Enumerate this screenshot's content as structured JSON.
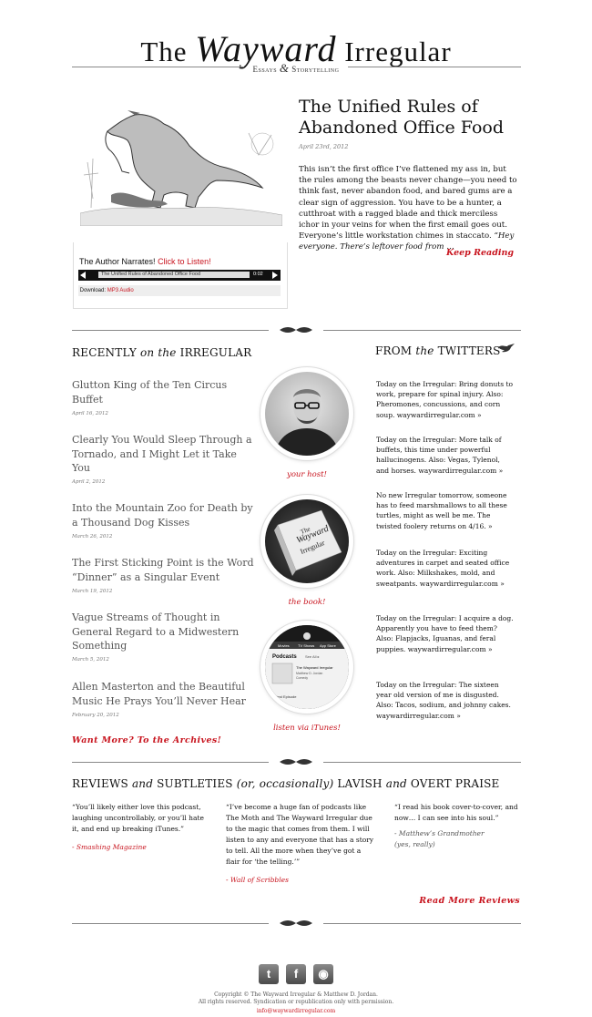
{
  "header": {
    "title_pre": "The ",
    "title_script": "Wayward",
    "title_post": " Irregular",
    "tagline_left": "Essays",
    "tagline_amp": "&",
    "tagline_right": "Storytelling"
  },
  "feature": {
    "title": "The Unified Rules of Abandoned Office Food",
    "date": "April 23rd, 2012",
    "excerpt": "This isn’t the first office I’ve flattened my ass in, but the rules among the beasts never change—you need to think fast, never abandon food, and bared gums are a clear sign of aggression. You have to be a hunter, a cutthroat with a ragged blade and thick merciless ichor in your veins for when the first email goes out. Everyone’s little workstation chimes in staccato.",
    "excerpt_italic": "“Hey everyone. There’s leftover food from …",
    "keep_reading": "Keep Reading",
    "audio": {
      "label": "The Author Narrates!",
      "link": "Click to Listen!",
      "track": "The Unified Rules of Abandoned Office Food",
      "time": "0:02",
      "download_label": "Download:",
      "download_link": "MP3 Audio"
    }
  },
  "recent": {
    "heading_a": "RECENTLY ",
    "heading_b": "on the",
    "heading_c": " IRREGULAR",
    "posts": [
      {
        "title": "Glutton King of the Ten Circus Buffet",
        "date": "April 16, 2012"
      },
      {
        "title": "Clearly You Would Sleep Through a Tornado, and I Might Let it Take You",
        "date": "April 2, 2012"
      },
      {
        "title": "Into the Mountain Zoo for Death by a Thousand Dog Kisses",
        "date": "March 26, 2012"
      },
      {
        "title": "The First Sticking Point is the Word “Dinner” as a Singular Event",
        "date": "March 19, 2012"
      },
      {
        "title": "Vague Streams of Thought in General Regard to a Midwestern Something",
        "date": "March 5, 2012"
      },
      {
        "title": "Allen Masterton and the Beautiful Music He Prays You’ll Never Hear",
        "date": "February 20, 2012"
      }
    ],
    "more": "Want More? To the Archives!"
  },
  "promos": {
    "host": "your host!",
    "book": "the book!",
    "itunes": "listen via iTunes!",
    "book_cover_line1": "The",
    "book_cover_line2": "Wayward",
    "book_cover_line3": "Irregular",
    "itunes_tabs": [
      "Movies",
      "TV Shows",
      "App Store"
    ],
    "itunes_heading": "Podcasts",
    "itunes_see_all": "See All ▸",
    "itunes_show": "The Wayward Irregular",
    "itunes_author": "Matthew D. Jordan",
    "itunes_cat": "Comedy",
    "itunes_episode": "Latest Episode"
  },
  "twitter": {
    "heading_a": "FROM ",
    "heading_b": "the",
    "heading_c": " TWITTERS",
    "tweets": [
      "Today on the Irregular: Bring donuts to work, prepare for spinal injury. Also: Pheromones, concussions, and corn soup. waywardirregular.com »",
      "Today on the Irregular: More talk of buffets, this time under powerful hallucinogens. Also: Vegas, Tylenol, and horses. waywardirregular.com »",
      "No new Irregular tomorrow, someone has to feed marshmallows to all these turtles, might as well be me. The twisted foolery returns on 4/16. »",
      "Today on the Irregular: Exciting adventures in carpet and seated office work. Also: Milkshakes, mold, and sweatpants. waywardirregular.com »",
      "Today on the Irregular: I acquire a dog. Apparently you have to feed them? Also: Flapjacks, Iguanas, and feral puppies. waywardirregular.com »",
      "Today on the Irregular: The sixteen year old version of me is disgusted. Also: Tacos, sodium, and johnny cakes. waywardirregular.com »"
    ]
  },
  "reviews": {
    "heading_1": "REVIEWS ",
    "heading_2": "and",
    "heading_3": " SUBTLETIES ",
    "heading_4": "(or, occasionally)",
    "heading_5": " LAVISH ",
    "heading_6": "and",
    "heading_7": " OVERT PRAISE",
    "items": [
      {
        "quote": "“You’ll likely either love this podcast, laughing uncontrollably, or you’ll hate it, and end up breaking iTunes.”",
        "source": "- Smashing Magazine"
      },
      {
        "quote": "“I’ve become a huge fan of podcasts like The Moth and The Wayward Irregular due to the magic that comes from them. I will listen to any and everyone that has a story to tell. All the more when they’ve got a flair for ‘the telling.’”",
        "source": "- Wall of Scribbles"
      },
      {
        "quote": "“I read his book cover-to-cover, and now… I can see into his soul.”",
        "source": "- Matthew’s Grandmother",
        "source_note": "(yes, really)"
      }
    ],
    "more": "Read More Reviews"
  },
  "footer": {
    "social": [
      {
        "name": "twitter",
        "glyph": "t"
      },
      {
        "name": "facebook",
        "glyph": "f"
      },
      {
        "name": "rss",
        "glyph": "◉"
      }
    ],
    "copyright_1": "Copyright © The Wayward Irregular & Matthew D. Jordan.",
    "copyright_2": "All rights reserved. Syndication or republication only with permission.",
    "email": "info@waywardirregular.com"
  },
  "colors": {
    "accent": "#c8141e",
    "text": "#222222",
    "muted": "#777777"
  }
}
